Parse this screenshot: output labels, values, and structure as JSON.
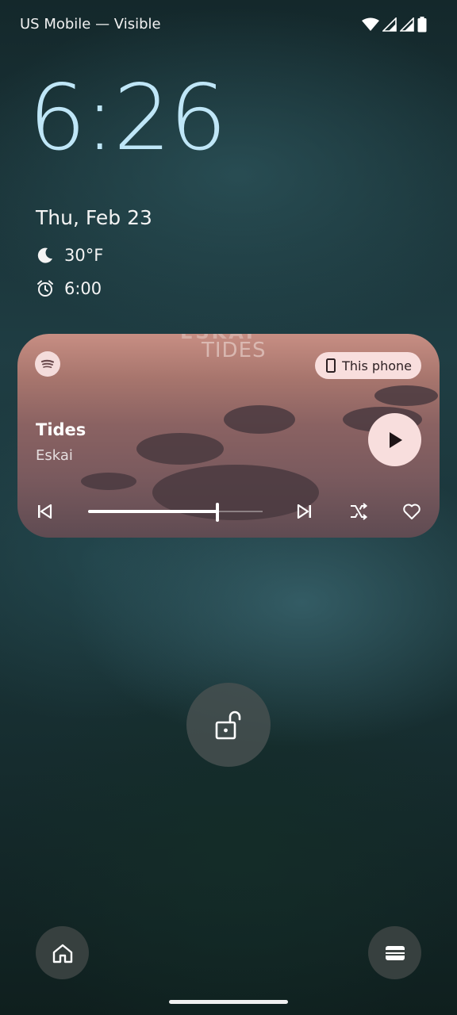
{
  "status_bar": {
    "carrier": "US Mobile — Visible",
    "icons": [
      "wifi-icon",
      "signal-icon",
      "signal-icon",
      "battery-icon"
    ]
  },
  "lockscreen": {
    "time": "6:26",
    "date": "Thu, Feb 23",
    "weather": {
      "icon": "moon-icon",
      "temperature": "30°F"
    },
    "alarm": {
      "icon": "alarm-clock-icon",
      "time": "6:00"
    }
  },
  "media": {
    "app_icon": "spotify-icon",
    "album_art_text_top": "ESKAI",
    "album_art_text": "TIDES",
    "output_device": "This phone",
    "title": "Tides",
    "artist": "Eskai",
    "progress": 0.74,
    "controls": [
      "previous-icon",
      "next-icon",
      "shuffle-icon",
      "heart-icon"
    ],
    "accent": "#f8dedd"
  },
  "bottom": {
    "left_shortcut": "home-icon",
    "right_shortcut": "wallet-icon",
    "lock_icon": "unlock-icon"
  },
  "colors": {
    "clock": "#bfe6f7",
    "card_chip": "#f8dedd"
  }
}
